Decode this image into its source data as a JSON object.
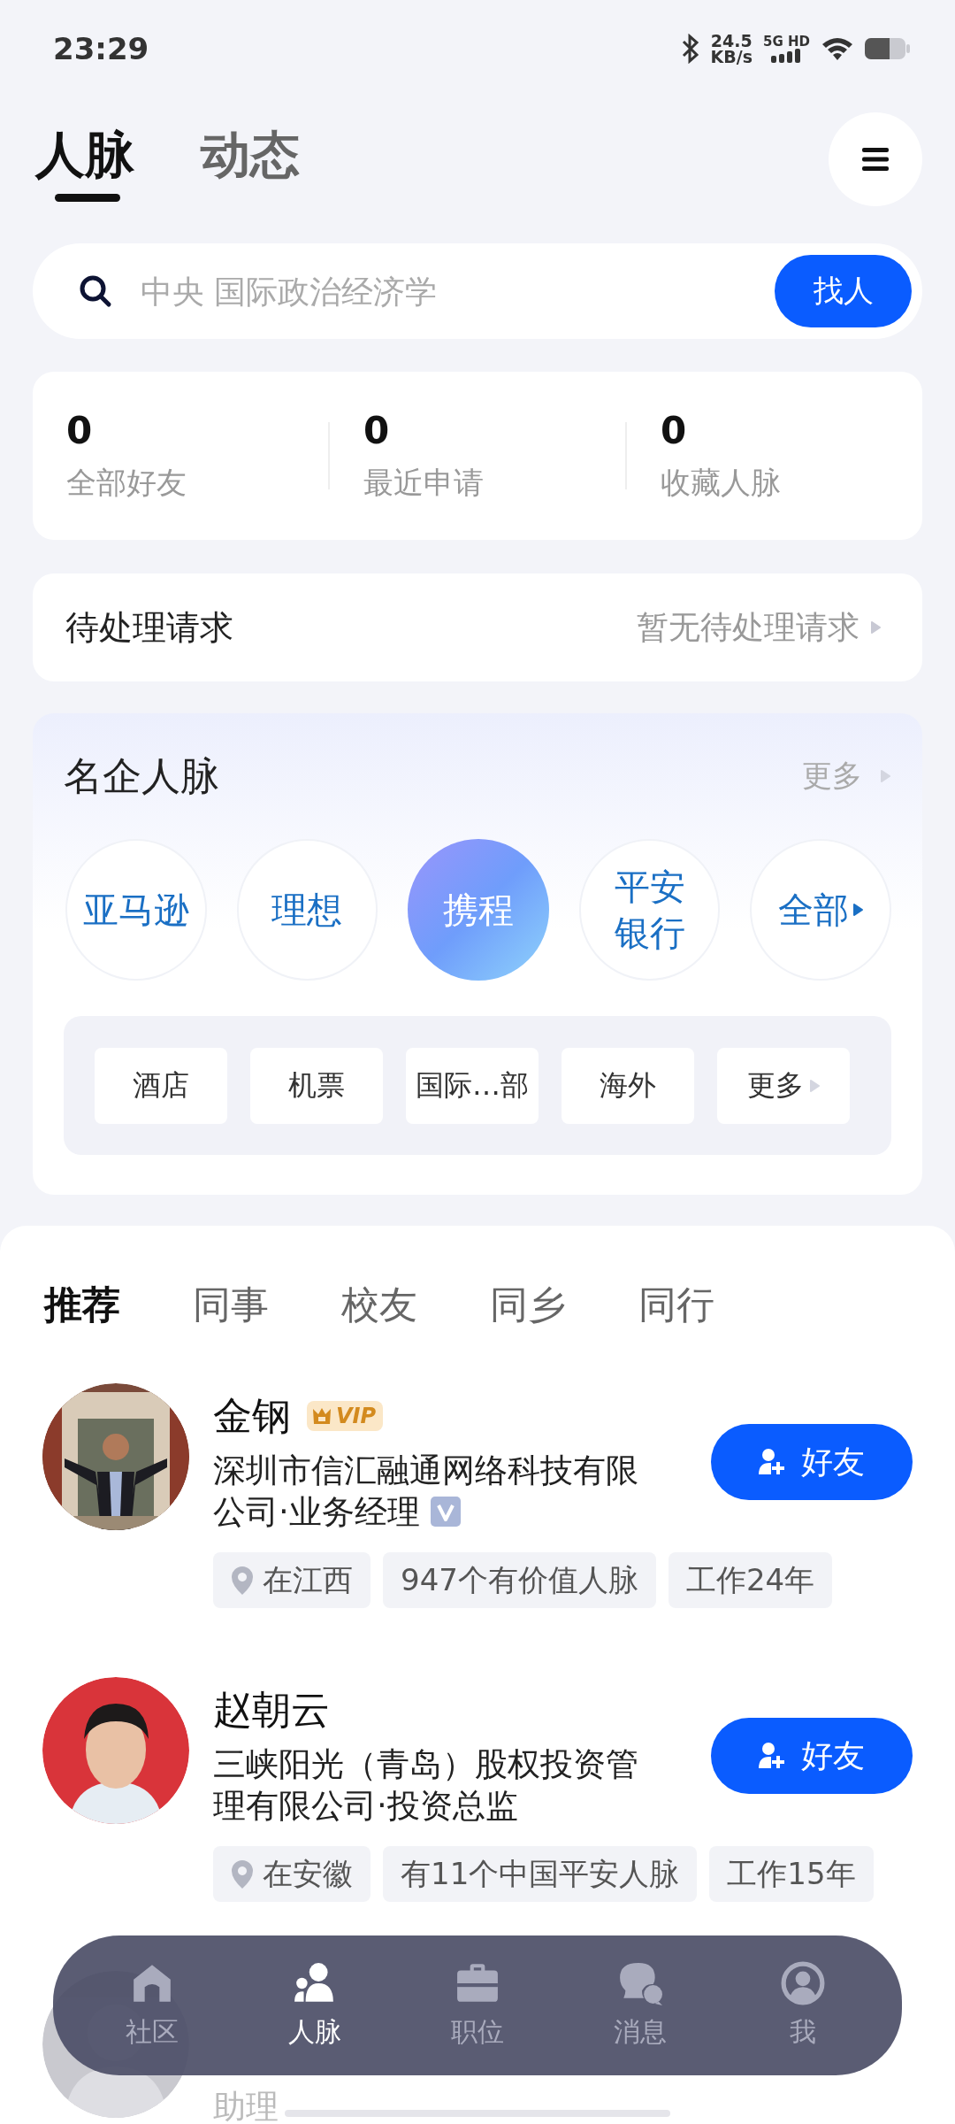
{
  "status_bar": {
    "time": "23:29",
    "net_speed": "24.5",
    "net_unit": "KB/s",
    "network": "5G HD"
  },
  "header_tabs": [
    {
      "label": "人脉",
      "selected": true
    },
    {
      "label": "动态",
      "selected": false
    }
  ],
  "search": {
    "placeholder": "中央 国际政治经济学",
    "button": "找人"
  },
  "stats": [
    {
      "value": "0",
      "label": "全部好友"
    },
    {
      "value": "0",
      "label": "最近申请"
    },
    {
      "value": "0",
      "label": "收藏人脉"
    }
  ],
  "pending": {
    "title": "待处理请求",
    "status": "暂无待处理请求"
  },
  "companies": {
    "title": "名企人脉",
    "more": "更多",
    "items": [
      {
        "label": "亚马逊",
        "kind": "company",
        "selected": false
      },
      {
        "label": "理想",
        "kind": "company",
        "selected": false
      },
      {
        "label": "携程",
        "kind": "company",
        "selected": true
      },
      {
        "label": "平安银行",
        "kind": "company",
        "selected": false
      },
      {
        "label": "全部",
        "kind": "all",
        "selected": false
      }
    ],
    "categories": [
      "酒店",
      "机票",
      "国际…部",
      "海外"
    ],
    "categories_more": "更多"
  },
  "people_tabs": [
    {
      "label": "推荐",
      "selected": true
    },
    {
      "label": "同事",
      "selected": false
    },
    {
      "label": "校友",
      "selected": false
    },
    {
      "label": "同乡",
      "selected": false
    },
    {
      "label": "同行",
      "selected": false
    }
  ],
  "people": [
    {
      "name": "金钢",
      "vip": true,
      "vip_label": "VIP",
      "company": "深圳市信汇融通网络科技有限公司·业务经理",
      "verified": true,
      "button": "好友",
      "chips": [
        {
          "text": "在江西",
          "kind": "location"
        },
        {
          "text": "947个有价值人脉",
          "kind": "plain"
        },
        {
          "text": "工作24年",
          "kind": "plain"
        }
      ]
    },
    {
      "name": "赵朝云",
      "vip": false,
      "company": "三峡阳光（青岛）股权投资管理有限公司·投资总监",
      "verified": false,
      "button": "好友",
      "chips": [
        {
          "text": "在安徽",
          "kind": "location"
        },
        {
          "text": "有11个中国平安人脉",
          "kind": "plain"
        },
        {
          "text": "工作15年",
          "kind": "plain"
        }
      ]
    }
  ],
  "people_partial": {
    "visible_text": "助理"
  },
  "nav": [
    {
      "label": "社区",
      "kind": "home",
      "selected": false
    },
    {
      "label": "人脉",
      "kind": "people",
      "selected": true
    },
    {
      "label": "职位",
      "kind": "jobs",
      "selected": false
    },
    {
      "label": "消息",
      "kind": "messages",
      "selected": false
    },
    {
      "label": "我",
      "kind": "profile",
      "selected": false
    }
  ]
}
